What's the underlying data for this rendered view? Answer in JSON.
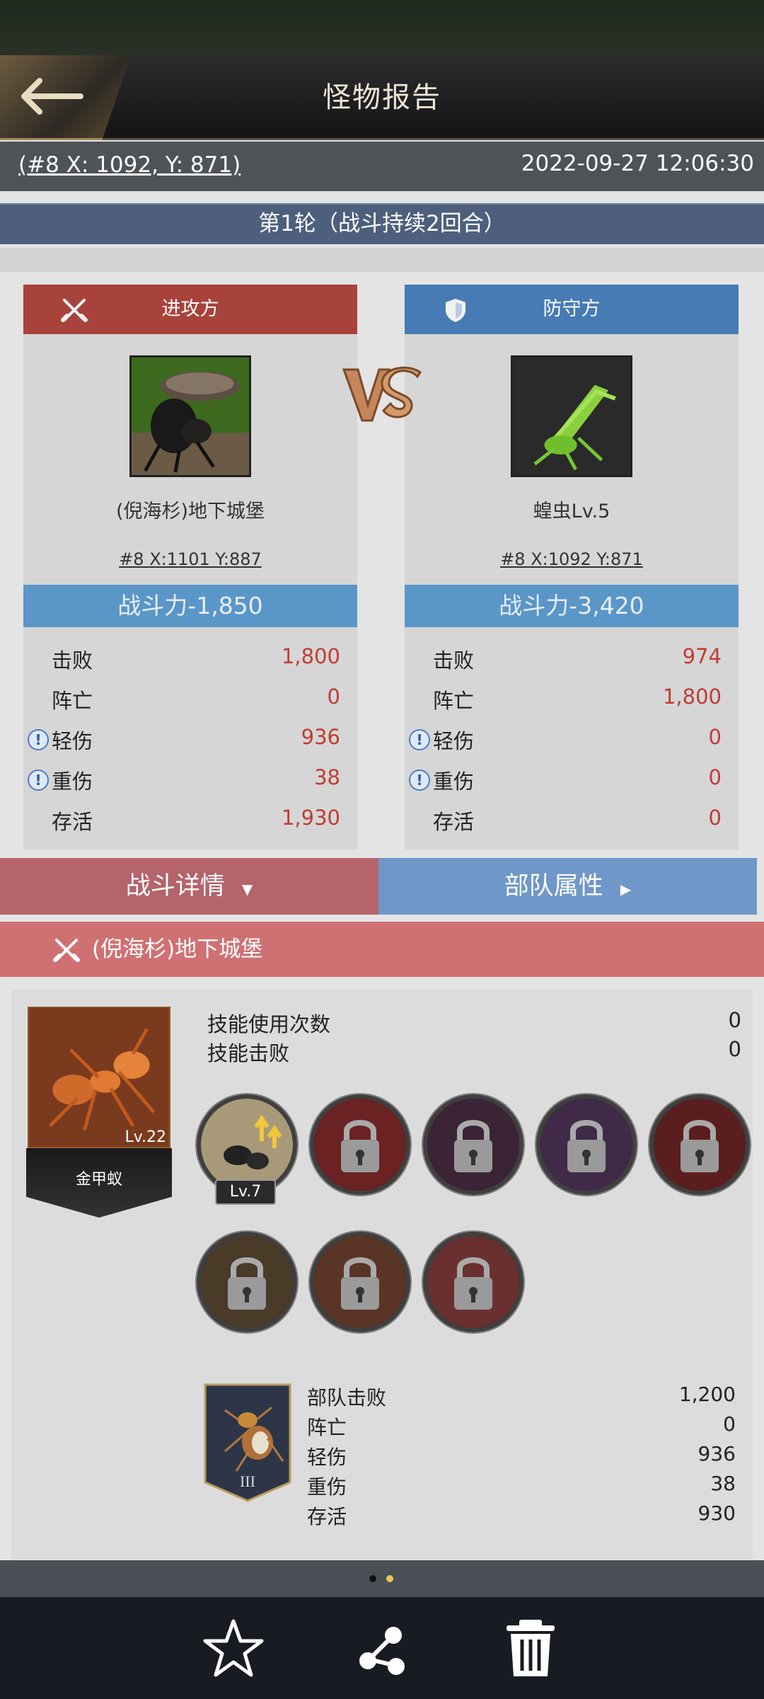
{
  "header": {
    "title": "怪物报告",
    "coord_link": "(#8 X: 1092, Y: 871)",
    "timestamp": "2022-09-27 12:06:30"
  },
  "round": {
    "label": "第1轮（战斗持续2回合）"
  },
  "attacker": {
    "side_label": "进攻方",
    "name": "(倪海杉)地下城堡",
    "location": "#8  X:1101  Y:887",
    "power": "战斗力-1,850",
    "stats": [
      {
        "label": "击败",
        "value": "1,800"
      },
      {
        "label": "阵亡",
        "value": "0"
      },
      {
        "label": "轻伤",
        "value": "936"
      },
      {
        "label": "重伤",
        "value": "38"
      },
      {
        "label": "存活",
        "value": "1,930"
      }
    ]
  },
  "defender": {
    "side_label": "防守方",
    "name": "蝗虫Lv.5",
    "location": "#8  X:1092  Y:871",
    "power": "战斗力-3,420",
    "stats": [
      {
        "label": "击败",
        "value": "974"
      },
      {
        "label": "阵亡",
        "value": "1,800"
      },
      {
        "label": "轻伤",
        "value": "0"
      },
      {
        "label": "重伤",
        "value": "0"
      },
      {
        "label": "存活",
        "value": "0"
      }
    ]
  },
  "info_mark": "!",
  "tabs": {
    "battle_details": "战斗详情",
    "troop_attributes": "部队属性"
  },
  "section": {
    "title": "(倪海杉)地下城堡"
  },
  "hero": {
    "level": "Lv.22",
    "name": "金甲蚁",
    "skill_uses_label": "技能使用次数",
    "skill_uses_value": "0",
    "skill_kills_label": "技能击败",
    "skill_kills_value": "0",
    "skill_level": "Lv.7"
  },
  "troop": {
    "tier": "III",
    "stats": [
      {
        "label": "部队击败",
        "value": "1,200"
      },
      {
        "label": "阵亡",
        "value": "0"
      },
      {
        "label": "轻伤",
        "value": "936"
      },
      {
        "label": "重伤",
        "value": "38"
      },
      {
        "label": "存活",
        "value": "930"
      }
    ]
  },
  "pagination": {
    "current": 1,
    "total": 2
  },
  "colors": {
    "attacker_red": "#a8433c",
    "defender_blue": "#467bb4",
    "power_blue": "#5b96c8",
    "loss_value_red": "#c23b32",
    "active_dot": "#e6c74e"
  },
  "icons": {
    "back": "back-arrow-icon",
    "attacker": "crossed-swords-icon",
    "defender": "shield-icon",
    "favorite": "star-icon",
    "share": "share-icon",
    "delete": "trash-icon"
  }
}
